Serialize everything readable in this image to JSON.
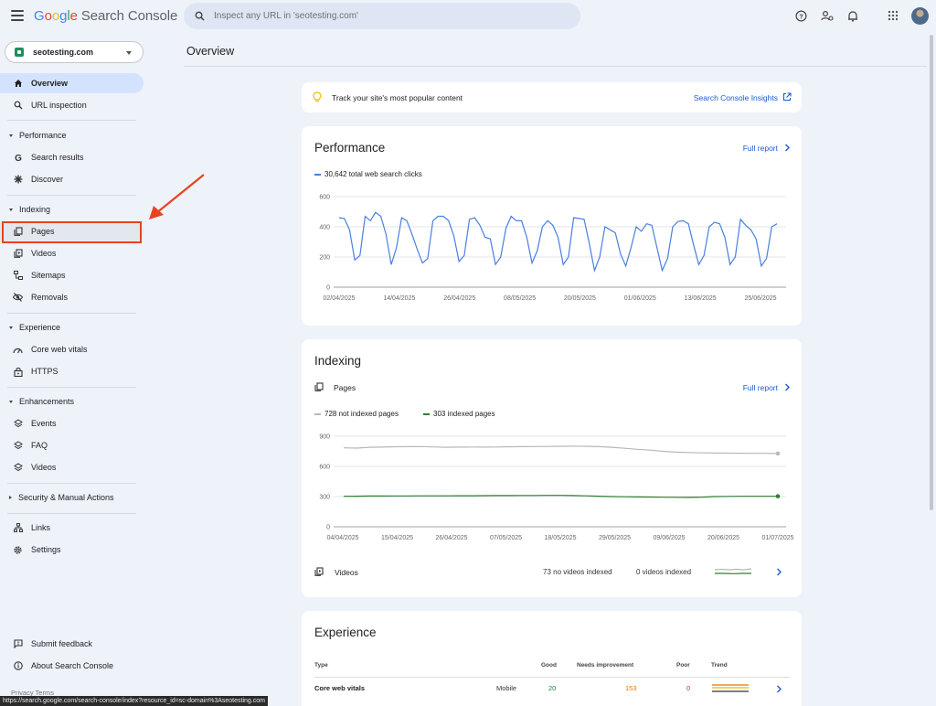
{
  "app": {
    "logo_google": "Google",
    "logo_product": "Search Console",
    "search_placeholder": "Inspect any URL in 'seotesting.com'"
  },
  "property": {
    "name": "seotesting.com"
  },
  "sidebar": {
    "overview": "Overview",
    "url_inspection": "URL inspection",
    "performance_head": "Performance",
    "search_results": "Search results",
    "discover": "Discover",
    "indexing_head": "Indexing",
    "pages": "Pages",
    "videos": "Videos",
    "sitemaps": "Sitemaps",
    "removals": "Removals",
    "experience_head": "Experience",
    "core_web_vitals": "Core web vitals",
    "https": "HTTPS",
    "enhancements_head": "Enhancements",
    "events": "Events",
    "faq": "FAQ",
    "enh_videos": "Videos",
    "security_head": "Security & Manual Actions",
    "links": "Links",
    "settings": "Settings",
    "submit_feedback": "Submit feedback",
    "about": "About Search Console",
    "footer": "Privacy   Terms"
  },
  "status_url": "https://search.google.com/search-console/index?resource_id=sc-domain%3Aseotesting.com",
  "main": {
    "title": "Overview",
    "insights_text": "Track your site's most popular content",
    "insights_link": "Search Console Insights",
    "performance": {
      "title": "Performance",
      "full_report": "Full report",
      "legend": "30,642 total web search clicks"
    },
    "indexing": {
      "title": "Indexing",
      "pages_label": "Pages",
      "full_report": "Full report",
      "legend_not_indexed": "728 not indexed pages",
      "legend_indexed": "303 indexed pages",
      "videos_label": "Videos",
      "videos_not_indexed": "73 no videos indexed",
      "videos_indexed": "0 videos indexed"
    },
    "experience": {
      "title": "Experience",
      "headers": {
        "type": "Type",
        "good": "Good",
        "needs": "Needs improvement",
        "poor": "Poor",
        "trend": "Trend"
      },
      "row": {
        "type": "Core web vitals",
        "device": "Mobile",
        "good": "20",
        "needs": "153",
        "poor": "0"
      }
    }
  },
  "colors": {
    "accent": "#1a5ad7",
    "clicks": "#4a7fe0",
    "not_indexed": "#b8b8b8",
    "indexed": "#2e7d32",
    "highlight": "#e8431e"
  },
  "chart_data": [
    {
      "type": "line",
      "title": "Performance",
      "series": [
        {
          "name": "30,642 total web search clicks",
          "values": [
            460,
            455,
            380,
            180,
            210,
            470,
            440,
            495,
            470,
            350,
            150,
            260,
            460,
            440,
            350,
            250,
            160,
            190,
            440,
            470,
            470,
            440,
            340,
            170,
            210,
            450,
            460,
            410,
            330,
            320,
            150,
            200,
            390,
            470,
            440,
            440,
            330,
            160,
            240,
            400,
            440,
            410,
            330,
            150,
            200,
            460,
            455,
            450,
            290,
            110,
            200,
            400,
            380,
            360,
            220,
            140,
            260,
            400,
            370,
            420,
            410,
            260,
            110,
            190,
            400,
            435,
            440,
            420,
            280,
            150,
            210,
            400,
            430,
            420,
            330,
            150,
            200,
            450,
            410,
            380,
            320,
            140,
            190,
            400,
            420
          ]
        }
      ],
      "x_ticks": [
        "02/04/2025",
        "14/04/2025",
        "26/04/2025",
        "08/05/2025",
        "20/05/2025",
        "01/06/2025",
        "13/06/2025",
        "25/06/2025"
      ],
      "y_ticks": [
        0,
        200,
        400,
        600
      ],
      "ylim": [
        0,
        600
      ]
    },
    {
      "type": "line",
      "title": "Indexing",
      "series": [
        {
          "name": "728 not indexed pages",
          "values": [
            785,
            782,
            790,
            792,
            795,
            796,
            797,
            794,
            790,
            792,
            793,
            792,
            793,
            795,
            796,
            797,
            798,
            800,
            801,
            800,
            796,
            790,
            780,
            770,
            762,
            750,
            742,
            738,
            735,
            733,
            732,
            731,
            730,
            730,
            728
          ]
        },
        {
          "name": "303 indexed pages",
          "values": [
            303,
            304,
            305,
            305,
            306,
            306,
            307,
            307,
            307,
            308,
            308,
            309,
            310,
            310,
            311,
            311,
            312,
            312,
            310,
            307,
            304,
            300,
            298,
            296,
            295,
            294,
            293,
            292,
            294,
            300,
            302,
            303,
            303,
            303,
            303
          ]
        }
      ],
      "x_ticks": [
        "04/04/2025",
        "15/04/2025",
        "26/04/2025",
        "07/05/2025",
        "18/05/2025",
        "29/05/2025",
        "09/06/2025",
        "20/06/2025",
        "01/07/2025"
      ],
      "y_ticks": [
        0,
        300,
        600,
        900
      ],
      "ylim": [
        0,
        900
      ]
    }
  ]
}
